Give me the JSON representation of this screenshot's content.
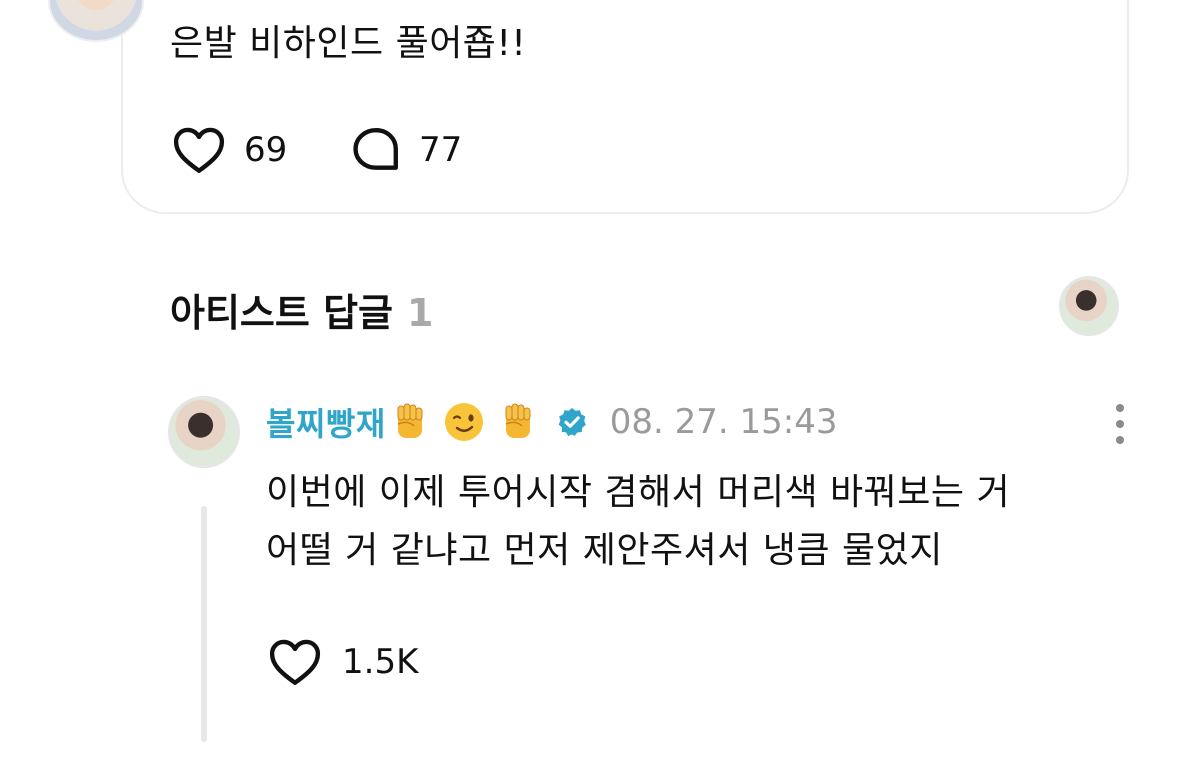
{
  "post": {
    "text": "은발 비하인드 풀어죱!!",
    "like_count": "69",
    "comment_count": "77"
  },
  "artist_replies": {
    "title": "아티스트 답글",
    "count": "1"
  },
  "reply": {
    "author": "볼찌빵재",
    "emojis": [
      "raised-fist",
      "winking-face",
      "raised-fist"
    ],
    "verified_badge_color": "#2fa6c9",
    "timestamp": "08. 27. 15:43",
    "text": "이번에 이제 투어시작 겸해서 머리색 바꿔보는 거\n어떨 거 같냐고 먼저 제안주셔서 냉큼 물었지",
    "like_count": "1.5K"
  },
  "colors": {
    "accent": "#2fa6c9",
    "muted": "#9a9a9a",
    "card_border": "#ececec"
  },
  "icons": {
    "like": "heart-outline-icon",
    "comment": "speech-bubble-icon",
    "more": "vertical-dots-icon",
    "verified": "verified-badge-icon"
  }
}
